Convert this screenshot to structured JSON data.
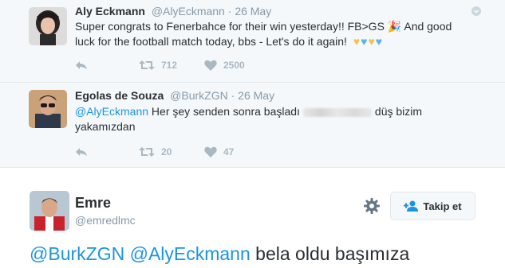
{
  "colors": {
    "link": "#1b95e0",
    "muted": "#8899a6",
    "text": "#292f33",
    "action": "#aab8c2"
  },
  "thread": {
    "tweets": [
      {
        "name": "Aly Eckmann",
        "handle": "@AlyEckmann",
        "dot": "·",
        "date": "26 May",
        "text": "Super congrats to Fenerbahce for their win yesterday!! FB>GS 🎉 And good luck for the football match today, bbs - Let's do it again!",
        "emoji_hearts": [
          "yellow",
          "blue",
          "yellow",
          "blue"
        ],
        "retweets": "712",
        "likes": "2500",
        "icons": [
          "reply-icon",
          "retweet-icon",
          "heart-icon",
          "chevron-down-icon"
        ]
      },
      {
        "name": "Egolas de Souza",
        "handle": "@BurkZGN",
        "dot": "·",
        "date": "26 May",
        "mention": "@AlyEckmann",
        "text_before": "Her şey senden sonra başladı",
        "text_after": "düş bizim yakamızdan",
        "retweets": "20",
        "likes": "47",
        "icons": [
          "reply-icon",
          "retweet-icon",
          "heart-icon"
        ]
      }
    ]
  },
  "main": {
    "name": "Emre",
    "handle": "@emredlmc",
    "follow_label": "Takip et",
    "mention1": "@BurkZGN",
    "mention2": "@AlyEckmann",
    "text": "bela oldu başımıza",
    "icons": [
      "gear-icon",
      "follow-user-icon"
    ]
  }
}
